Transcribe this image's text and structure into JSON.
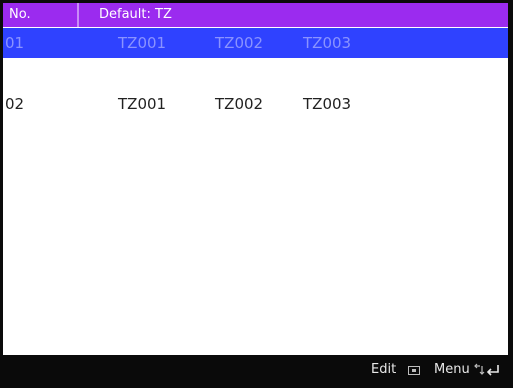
{
  "header": {
    "col_no": "No.",
    "col_timezone": "Default: TZ"
  },
  "rows": [
    {
      "no": "01",
      "tz1": "TZ001",
      "tz2": "TZ002",
      "tz3": "TZ003",
      "selected": true
    },
    {
      "no": "02",
      "tz1": "TZ001",
      "tz2": "TZ002",
      "tz3": "TZ003",
      "selected": false
    }
  ],
  "footer": {
    "edit_label": "Edit",
    "edit_icon": "ok-key-icon",
    "menu_label": "Menu",
    "menu_icon": "arrow-enter-icon"
  },
  "colors": {
    "header_bg": "#9b2bef",
    "selected_row_bg": "#2f42ff",
    "footer_bg": "#0a0a0a"
  }
}
